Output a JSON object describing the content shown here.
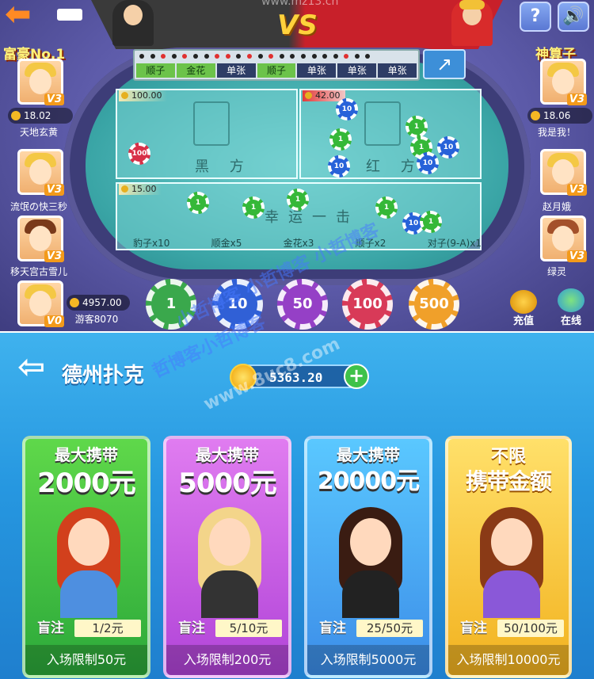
{
  "game": {
    "watermark_url": "www.mz13.cn",
    "vs": "VS",
    "history": {
      "dots": [
        "b",
        "b",
        "r",
        "b",
        "r",
        "b",
        "b",
        "r",
        "r",
        "b",
        "r",
        "b",
        "r",
        "b",
        "b",
        "b",
        "b",
        "b",
        "b",
        "r",
        "b",
        "b"
      ],
      "cells": [
        {
          "label": "顺子",
          "green": true
        },
        {
          "label": "金花",
          "green": true
        },
        {
          "label": "单张",
          "green": false
        },
        {
          "label": "顺子",
          "green": true
        },
        {
          "label": "单张",
          "green": false
        },
        {
          "label": "单张",
          "green": false
        },
        {
          "label": "单张",
          "green": false
        }
      ]
    },
    "black_side": {
      "bet": "100.00",
      "name": "黑 方"
    },
    "red_side": {
      "bet": "42.00",
      "name": "红 方"
    },
    "lucky": {
      "bet": "15.00",
      "name": "幸运一击"
    },
    "patterns": [
      "豹子x10",
      "顺金x5",
      "金花x3",
      "顺子x2",
      "对子(9-A)x1"
    ],
    "chips_on_table": {
      "black": [
        "100"
      ],
      "red": [
        "10",
        "1",
        "10",
        "1",
        "1",
        "10",
        "10",
        "10"
      ],
      "lucky": [
        "1",
        "1",
        "1",
        "1",
        "10",
        "1"
      ]
    },
    "chip_tray": [
      "1",
      "10",
      "50",
      "100",
      "500"
    ],
    "left_title": "富豪No.1",
    "right_title": "神算子",
    "players_left": [
      {
        "name": "天地玄黄",
        "coins": "18.02",
        "level": "V3"
      },
      {
        "name": "流氓の快三秒",
        "level": "V3"
      },
      {
        "name": "移天宫古雪儿",
        "level": "V3"
      },
      {
        "name": "游客8070",
        "coins": "4957.00",
        "level": "V0"
      }
    ],
    "players_right": [
      {
        "name": "我是我！",
        "coins": "18.06",
        "level": "V3"
      },
      {
        "name": "赵月娥",
        "level": "V3"
      },
      {
        "name": "绿灵",
        "level": "V3"
      }
    ],
    "recharge_label": "充值",
    "online_label": "在线",
    "help_label": "?",
    "sound_label": "🔊"
  },
  "lobby": {
    "title": "德州扑克",
    "balance": "5363.20",
    "watermarks": [
      "小哲博客 小哲博客 小哲博客",
      "www.8uc8.com",
      "哲博客小哲博客"
    ],
    "rooms": [
      {
        "line1": "最大携带",
        "line2": "2000元",
        "blind_label": "盲注",
        "blind": "1/2元",
        "entry": "入场限制50元"
      },
      {
        "line1": "最大携带",
        "line2": "5000元",
        "blind_label": "盲注",
        "blind": "5/10元",
        "entry": "入场限制200元"
      },
      {
        "line1": "最大携带",
        "line2": "20000元",
        "blind_label": "盲注",
        "blind": "25/50元",
        "entry": "入场限制5000元"
      },
      {
        "line1": "不限",
        "line2": "携带金额",
        "blind_label": "盲注",
        "blind": "50/100元",
        "entry": "入场限制10000元"
      }
    ]
  }
}
